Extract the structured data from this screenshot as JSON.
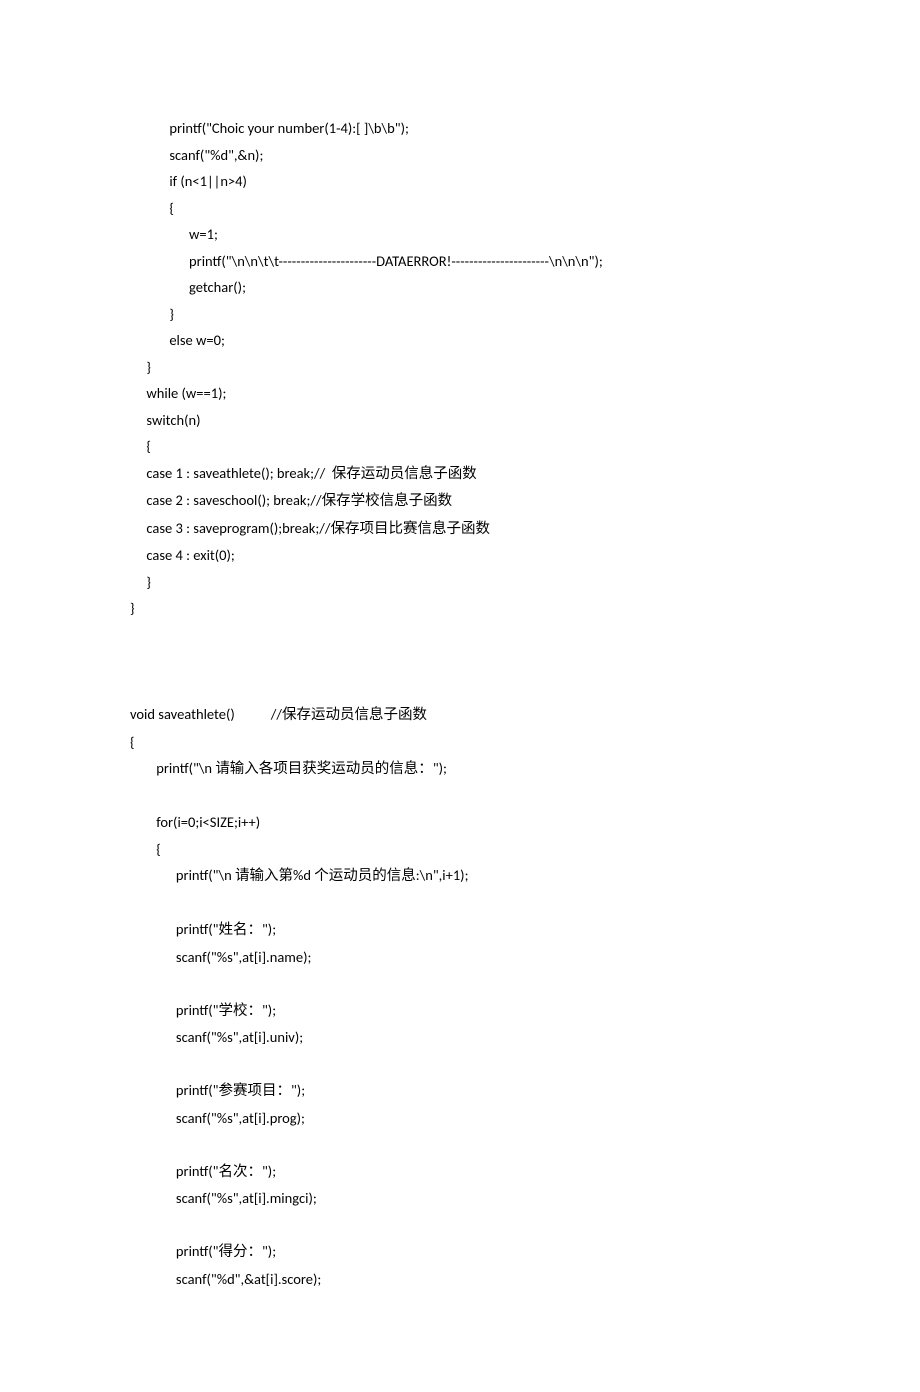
{
  "code": {
    "line01": "            printf(\"Choic your number(1-4):[ ]\\b\\b\");",
    "line02": "            scanf(\"%d\",&n);",
    "line03": "            if (n<1||n>4)",
    "line04": "            {",
    "line05": "                  w=1;",
    "line06": "                  printf(\"\\n\\n\\t\\t----------------------DATAERROR!----------------------\\n\\n\\n\");",
    "line07": "                  getchar();",
    "line08": "            }",
    "line09": "            else w=0;",
    "line10": "     }",
    "line11": "     while (w==1);",
    "line12": "     switch(n)",
    "line13": "     {",
    "line14a": "     case 1 : saveathlete(); break;//  ",
    "line14b": "保存运动员信息子函数",
    "line15a": "     case 2 : saveschool(); break;//",
    "line15b": "保存学校信息子函数",
    "line16a": "     case 3 : saveprogram();break;//",
    "line16b": "保存项目比赛信息子函数",
    "line17": "     case 4 : exit(0);",
    "line18": "     }",
    "line19": "}",
    "line20": "",
    "line21": "",
    "line22": "",
    "line23a": "void saveathlete()           //",
    "line23b": "保存运动员信息子函数",
    "line24": "{",
    "line25a": "        printf(\"\\n ",
    "line25b": "请输入各项目获奖运动员的信息：",
    "line25c": "\");",
    "line26": "",
    "line27": "        for(i=0;i<SIZE;i++)",
    "line28": "        {",
    "line29a": "              printf(\"\\n ",
    "line29b": "请输入第",
    "line29c": "%d ",
    "line29d": "个运动员的信息",
    "line29e": ":\\n\",i+1);",
    "line30": "",
    "line31a": "              printf(\"",
    "line31b": "姓名：",
    "line31c": "\");",
    "line32": "              scanf(\"%s\",at[i].name);",
    "line33": "",
    "line34a": "              printf(\"",
    "line34b": "学校：",
    "line34c": "\");",
    "line35": "              scanf(\"%s\",at[i].univ);",
    "line36": "",
    "line37a": "              printf(\"",
    "line37b": "参赛项目：",
    "line37c": "\");",
    "line38": "              scanf(\"%s\",at[i].prog);",
    "line39": "",
    "line40a": "              printf(\"",
    "line40b": "名次：",
    "line40c": "\");",
    "line41": "              scanf(\"%s\",at[i].mingci);",
    "line42": "",
    "line43a": "              printf(\"",
    "line43b": "得分：",
    "line43c": "\");",
    "line44": "              scanf(\"%d\",&at[i].score);"
  }
}
